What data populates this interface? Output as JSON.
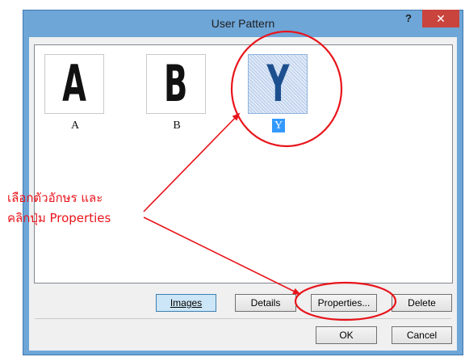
{
  "window": {
    "title": "User Pattern",
    "help_label": "?",
    "close_label": "✕"
  },
  "patterns": [
    {
      "glyph": "A",
      "label": "A",
      "selected": false
    },
    {
      "glyph": "B",
      "label": "B",
      "selected": false
    },
    {
      "glyph": "Y",
      "label": "Y",
      "selected": true
    }
  ],
  "buttons": {
    "images": "Images",
    "details": "Details",
    "properties": "Properties...",
    "delete": "Delete",
    "ok": "OK",
    "cancel": "Cancel"
  },
  "annotation": {
    "line1": "เลือกตัวอักษร และ",
    "line2": "คลิกปุ่ม Properties",
    "color": "#e8141b"
  }
}
